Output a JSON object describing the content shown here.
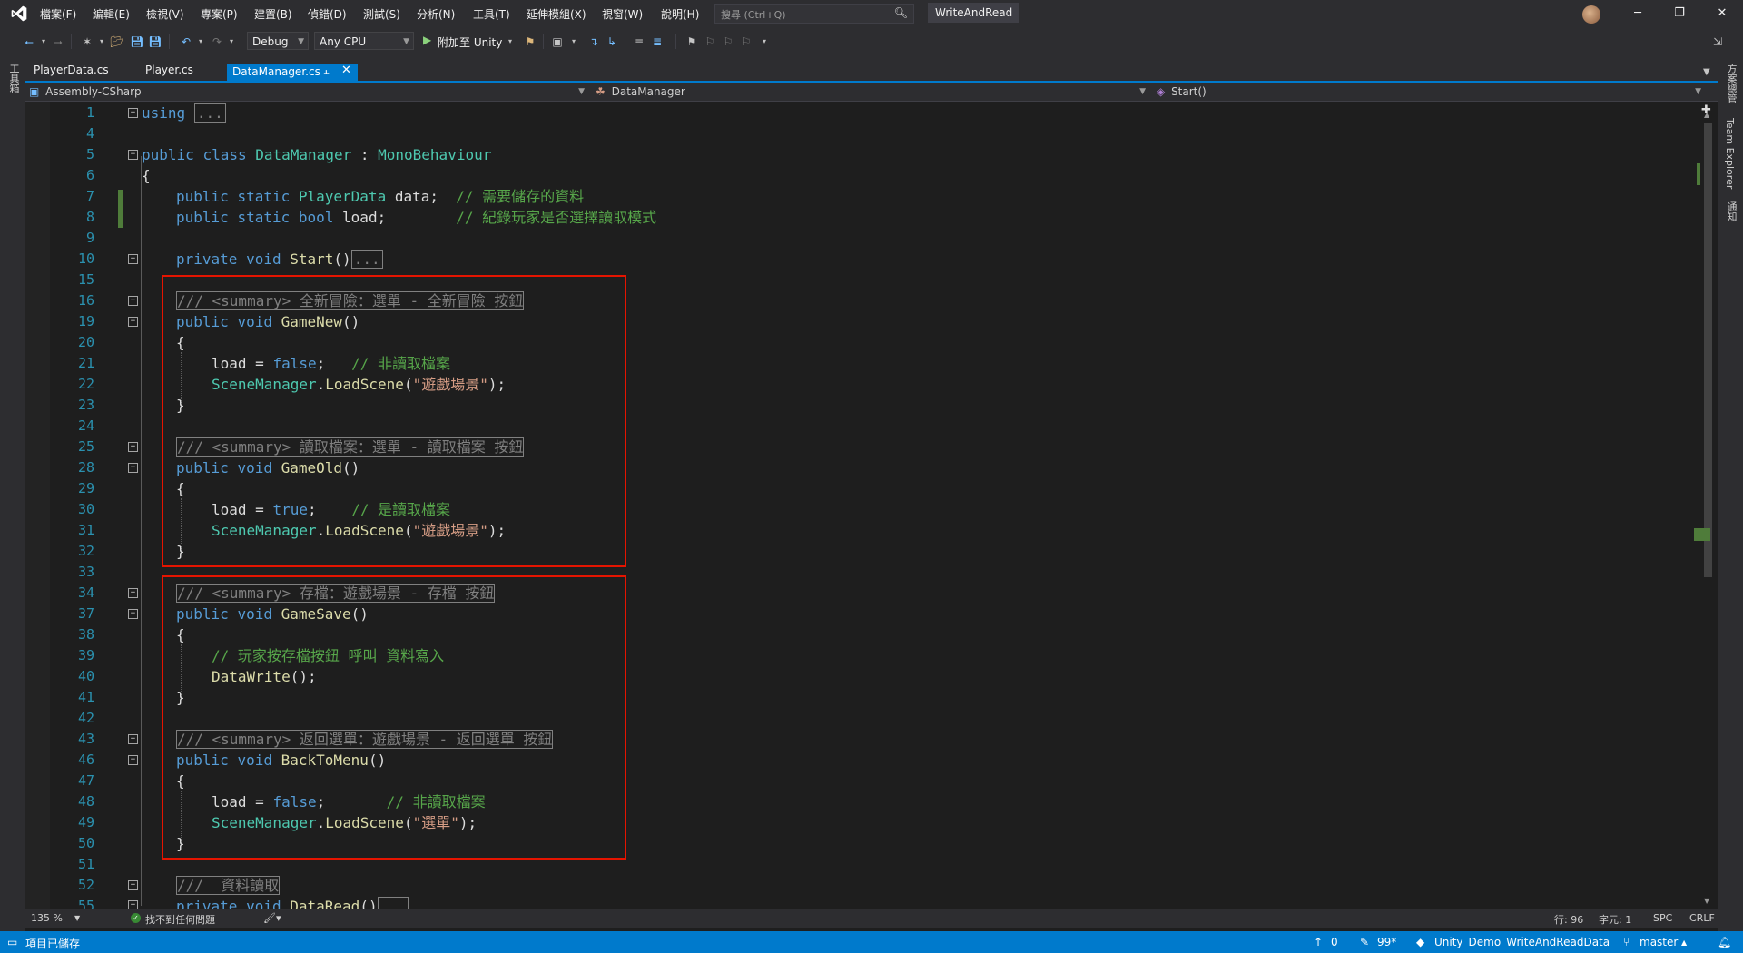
{
  "window": {
    "solution_title": "WriteAndRead",
    "minimize": "─",
    "maximize": "❐",
    "close": "✕"
  },
  "menu": [
    {
      "label": "檔案(F)"
    },
    {
      "label": "編輯(E)"
    },
    {
      "label": "檢視(V)"
    },
    {
      "label": "專案(P)"
    },
    {
      "label": "建置(B)"
    },
    {
      "label": "偵錯(D)"
    },
    {
      "label": "測試(S)"
    },
    {
      "label": "分析(N)"
    },
    {
      "label": "工具(T)"
    },
    {
      "label": "延伸模組(X)"
    },
    {
      "label": "視窗(W)"
    },
    {
      "label": "說明(H)"
    }
  ],
  "search": {
    "placeholder": "搜尋 (Ctrl+Q)"
  },
  "toolbar": {
    "config": "Debug",
    "platform": "Any CPU",
    "attach_label": "附加至 Unity"
  },
  "left_panel": {
    "toolbox_label": "工具箱"
  },
  "right_panel": {
    "solution_explorer": "方案總管",
    "team_explorer": "Team Explorer",
    "notifications": "通知"
  },
  "tabs": [
    {
      "label": "PlayerData.cs"
    },
    {
      "label": "Player.cs"
    },
    {
      "label": "DataManager.cs",
      "active": true
    }
  ],
  "nav": {
    "project": "Assembly-CSharp",
    "class": "DataManager",
    "member": "Start()"
  },
  "code": {
    "line_numbers": [
      "1",
      "4",
      "5",
      "6",
      "7",
      "8",
      "9",
      "10",
      "15",
      "16",
      "19",
      "20",
      "21",
      "22",
      "23",
      "24",
      "25",
      "28",
      "29",
      "30",
      "31",
      "32",
      "33",
      "34",
      "37",
      "38",
      "39",
      "40",
      "41",
      "42",
      "43",
      "46",
      "47",
      "48",
      "49",
      "50",
      "51",
      "52",
      "55"
    ],
    "using_kw": "using",
    "collapsed": "...",
    "public": "public",
    "private": "private",
    "class": "class",
    "static": "static",
    "void": "void",
    "bool": "bool",
    "false": "false",
    "true": "true",
    "class_name": "DataManager",
    "colon": " : ",
    "base_class": "MonoBehaviour",
    "open_brace": "{",
    "close_brace": "}",
    "player_data_type": "PlayerData",
    "data_field": " data;  ",
    "comment_data": "// 需要儲存的資料",
    "load_field": " load;        ",
    "comment_load": "// 紀錄玩家是否選擇讀取模式",
    "start_fn": "Start",
    "parens": "()",
    "doc_prefix": "/// ",
    "summary_tag": "<summary>",
    "summary_new": " 全新冒險：選單 - 全新冒險 按鈕",
    "fn_game_new": "GameNew",
    "load_assign": "load = ",
    "semi_pad_3": ";   ",
    "semi_pad_4": ";    ",
    "semi_pad_7": ";       ",
    "comment_not_read": "// 非讀取檔案",
    "comment_is_read": "// 是讀取檔案",
    "scene_manager": "SceneManager",
    "dot": ".",
    "load_scene": "LoadScene",
    "open_paren": "(",
    "close_paren_semi": ");",
    "str_game_scene": "\"遊戲場景\"",
    "str_menu": "\"選單\"",
    "summary_old": " 讀取檔案：選單 - 讀取檔案 按鈕",
    "fn_game_old": "GameOld",
    "summary_save": " 存檔：遊戲場景 - 存檔 按鈕",
    "fn_game_save": "GameSave",
    "comment_save": "// 玩家按存檔按鈕 呼叫 資料寫入",
    "fn_data_write": "DataWrite",
    "call_end": "();",
    "summary_back": " 返回選單：遊戲場景 - 返回選單 按鈕",
    "fn_back_to_menu": "BackToMenu",
    "summary_read": " 資料讀取",
    "fn_data_read": "DataRead"
  },
  "infobar": {
    "zoom": "135 %",
    "issues": "找不到任何問題",
    "row": "行: 96",
    "col": "字元: 1",
    "spc": "SPC",
    "crlf": "CRLF"
  },
  "statusbar": {
    "ready": "項目已儲存",
    "up_count": "0",
    "edits": "99*",
    "repo": "Unity_Demo_WriteAndReadData",
    "branch": "master"
  }
}
